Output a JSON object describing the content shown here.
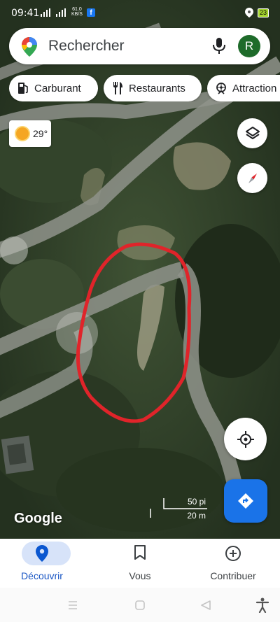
{
  "status_bar": {
    "time": "09:41",
    "net_speed_top": "61.0",
    "net_speed_bottom": "KB/S",
    "fb_letter": "f",
    "battery": "23"
  },
  "search": {
    "placeholder": "Rechercher",
    "avatar_letter": "R"
  },
  "chips": [
    {
      "label": "Carburant",
      "icon": "fuel-icon"
    },
    {
      "label": "Restaurants",
      "icon": "restaurant-icon"
    },
    {
      "label": "Attraction",
      "icon": "attraction-icon"
    }
  ],
  "weather": {
    "temp": "29°",
    "icon": "sun-icon"
  },
  "map": {
    "attribution": "Google",
    "scale_imperial": "50 pi",
    "scale_metric": "20 m"
  },
  "bottom_nav": [
    {
      "label": "Découvrir",
      "icon": "location-pin-icon",
      "active": true
    },
    {
      "label": "Vous",
      "icon": "bookmark-icon",
      "active": false
    },
    {
      "label": "Contribuer",
      "icon": "add-circle-icon",
      "active": false
    }
  ],
  "colors": {
    "accent": "#1a73e8",
    "active_pill": "#d7e3f9",
    "annotation_red": "#e0242a"
  }
}
